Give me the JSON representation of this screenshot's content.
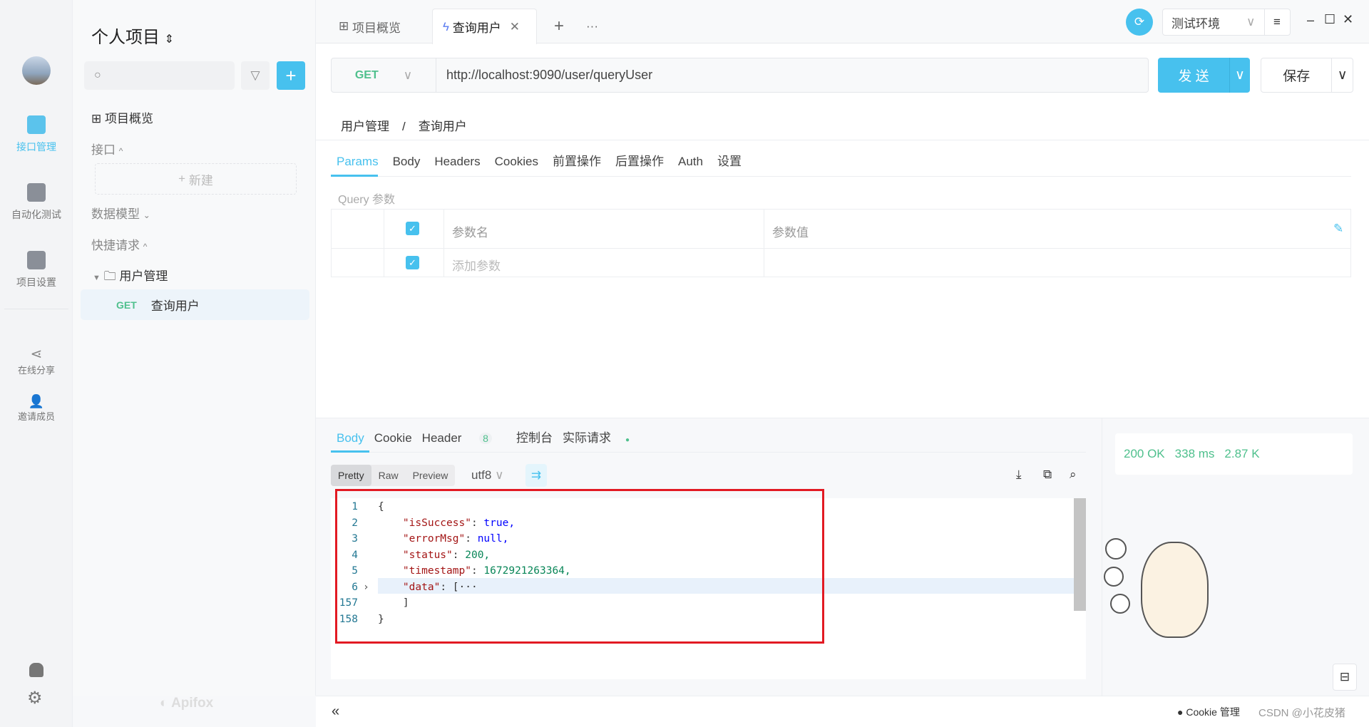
{
  "rail": {
    "items": [
      {
        "label": "接口管理",
        "active": true
      },
      {
        "label": "自动化测试"
      },
      {
        "label": "项目设置"
      },
      {
        "label": "在线分享"
      },
      {
        "label": "邀请成员"
      }
    ]
  },
  "sidebar": {
    "project_title": "个人项目",
    "search_placeholder": "",
    "overview": "项目概览",
    "section_api": "接口",
    "new_label": "新建",
    "section_models": "数据模型",
    "section_quick": "快捷请求",
    "folder": "用户管理",
    "request": {
      "method": "GET",
      "name": "查询用户"
    },
    "brand": "Apifox"
  },
  "tabs": {
    "items": [
      {
        "label": "项目概览"
      },
      {
        "label": "查询用户",
        "active": true
      }
    ]
  },
  "env": {
    "selected": "测试环境"
  },
  "request": {
    "method": "GET",
    "url": "http://localhost:9090/user/queryUser",
    "send": "发 送",
    "save": "保存"
  },
  "breadcrumb": {
    "parent": "用户管理",
    "sep": "/",
    "current": "查询用户"
  },
  "param_tabs": [
    "Params",
    "Body",
    "Headers",
    "Cookies",
    "前置操作",
    "后置操作",
    "Auth",
    "设置"
  ],
  "query": {
    "title": "Query 参数",
    "col_name": "参数名",
    "col_value": "参数值",
    "add_placeholder": "添加参数"
  },
  "response": {
    "tabs": [
      "Body",
      "Cookie",
      "Header",
      "控制台",
      "实际请求"
    ],
    "header_count": "8",
    "formats": [
      "Pretty",
      "Raw",
      "Preview"
    ],
    "encoding": "utf8",
    "status": "200 OK",
    "time": "338 ms",
    "size": "2.87 K",
    "lines": [
      {
        "n": "1",
        "t": "{"
      },
      {
        "n": "2",
        "k": "\"isSuccess\"",
        "v": "true,",
        "vt": "b"
      },
      {
        "n": "3",
        "k": "\"errorMsg\"",
        "v": "null,",
        "vt": "b"
      },
      {
        "n": "4",
        "k": "\"status\"",
        "v": "200,",
        "vt": "n"
      },
      {
        "n": "5",
        "k": "\"timestamp\"",
        "v": "1672921263364,",
        "vt": "n"
      },
      {
        "n": "6",
        "k": "\"data\"",
        "v": "[···",
        "vt": "p"
      },
      {
        "n": "157",
        "t": "    ]"
      },
      {
        "n": "158",
        "t": "}"
      }
    ]
  },
  "footer": {
    "cookie": "Cookie 管理",
    "watermark": "CSDN @小花皮猪"
  },
  "colors": {
    "accent": "#47c1ee",
    "get": "#4fc08d",
    "highlight": "#e21a23"
  }
}
